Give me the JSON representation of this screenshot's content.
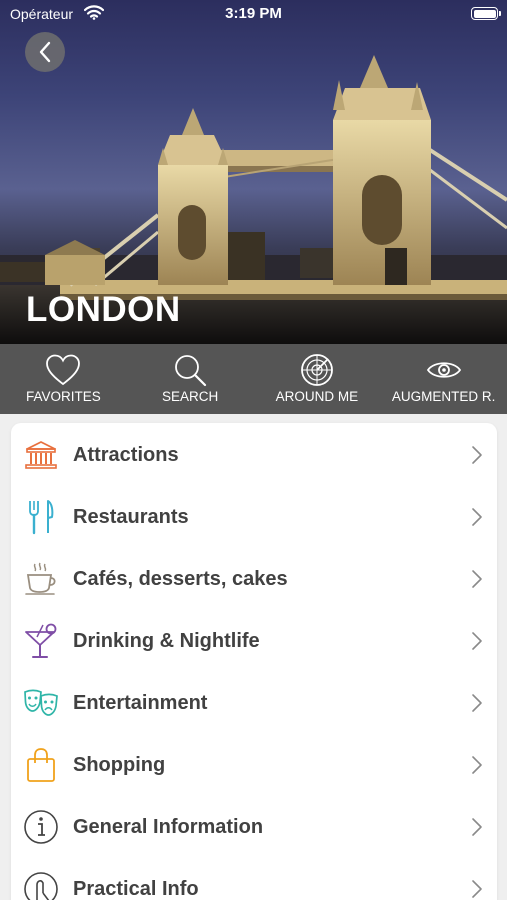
{
  "status_bar": {
    "carrier": "Opérateur",
    "time": "3:19 PM"
  },
  "header": {
    "city": "LONDON"
  },
  "toolbar": [
    {
      "label": "FAVORITES",
      "icon": "heart-icon"
    },
    {
      "label": "SEARCH",
      "icon": "search-icon"
    },
    {
      "label": "AROUND ME",
      "icon": "radar-icon"
    },
    {
      "label": "AUGMENTED R.",
      "icon": "eye-icon"
    }
  ],
  "categories": [
    {
      "label": "Attractions",
      "icon": "monument-icon",
      "color": "#e8703e"
    },
    {
      "label": "Restaurants",
      "icon": "fork-knife-icon",
      "color": "#3ab0cf"
    },
    {
      "label": "Cafés, desserts, cakes",
      "icon": "coffee-cup-icon",
      "color": "#9a8f80"
    },
    {
      "label": "Drinking & Nightlife",
      "icon": "cocktail-icon",
      "color": "#7f4ea6"
    },
    {
      "label": "Entertainment",
      "icon": "theater-masks-icon",
      "color": "#2fb5a8"
    },
    {
      "label": "Shopping",
      "icon": "shopping-bag-icon",
      "color": "#f0a21c"
    },
    {
      "label": "General Information",
      "icon": "info-icon",
      "color": "#444444"
    },
    {
      "label": "Practical Info",
      "icon": "practical-info-icon",
      "color": "#444444"
    }
  ]
}
